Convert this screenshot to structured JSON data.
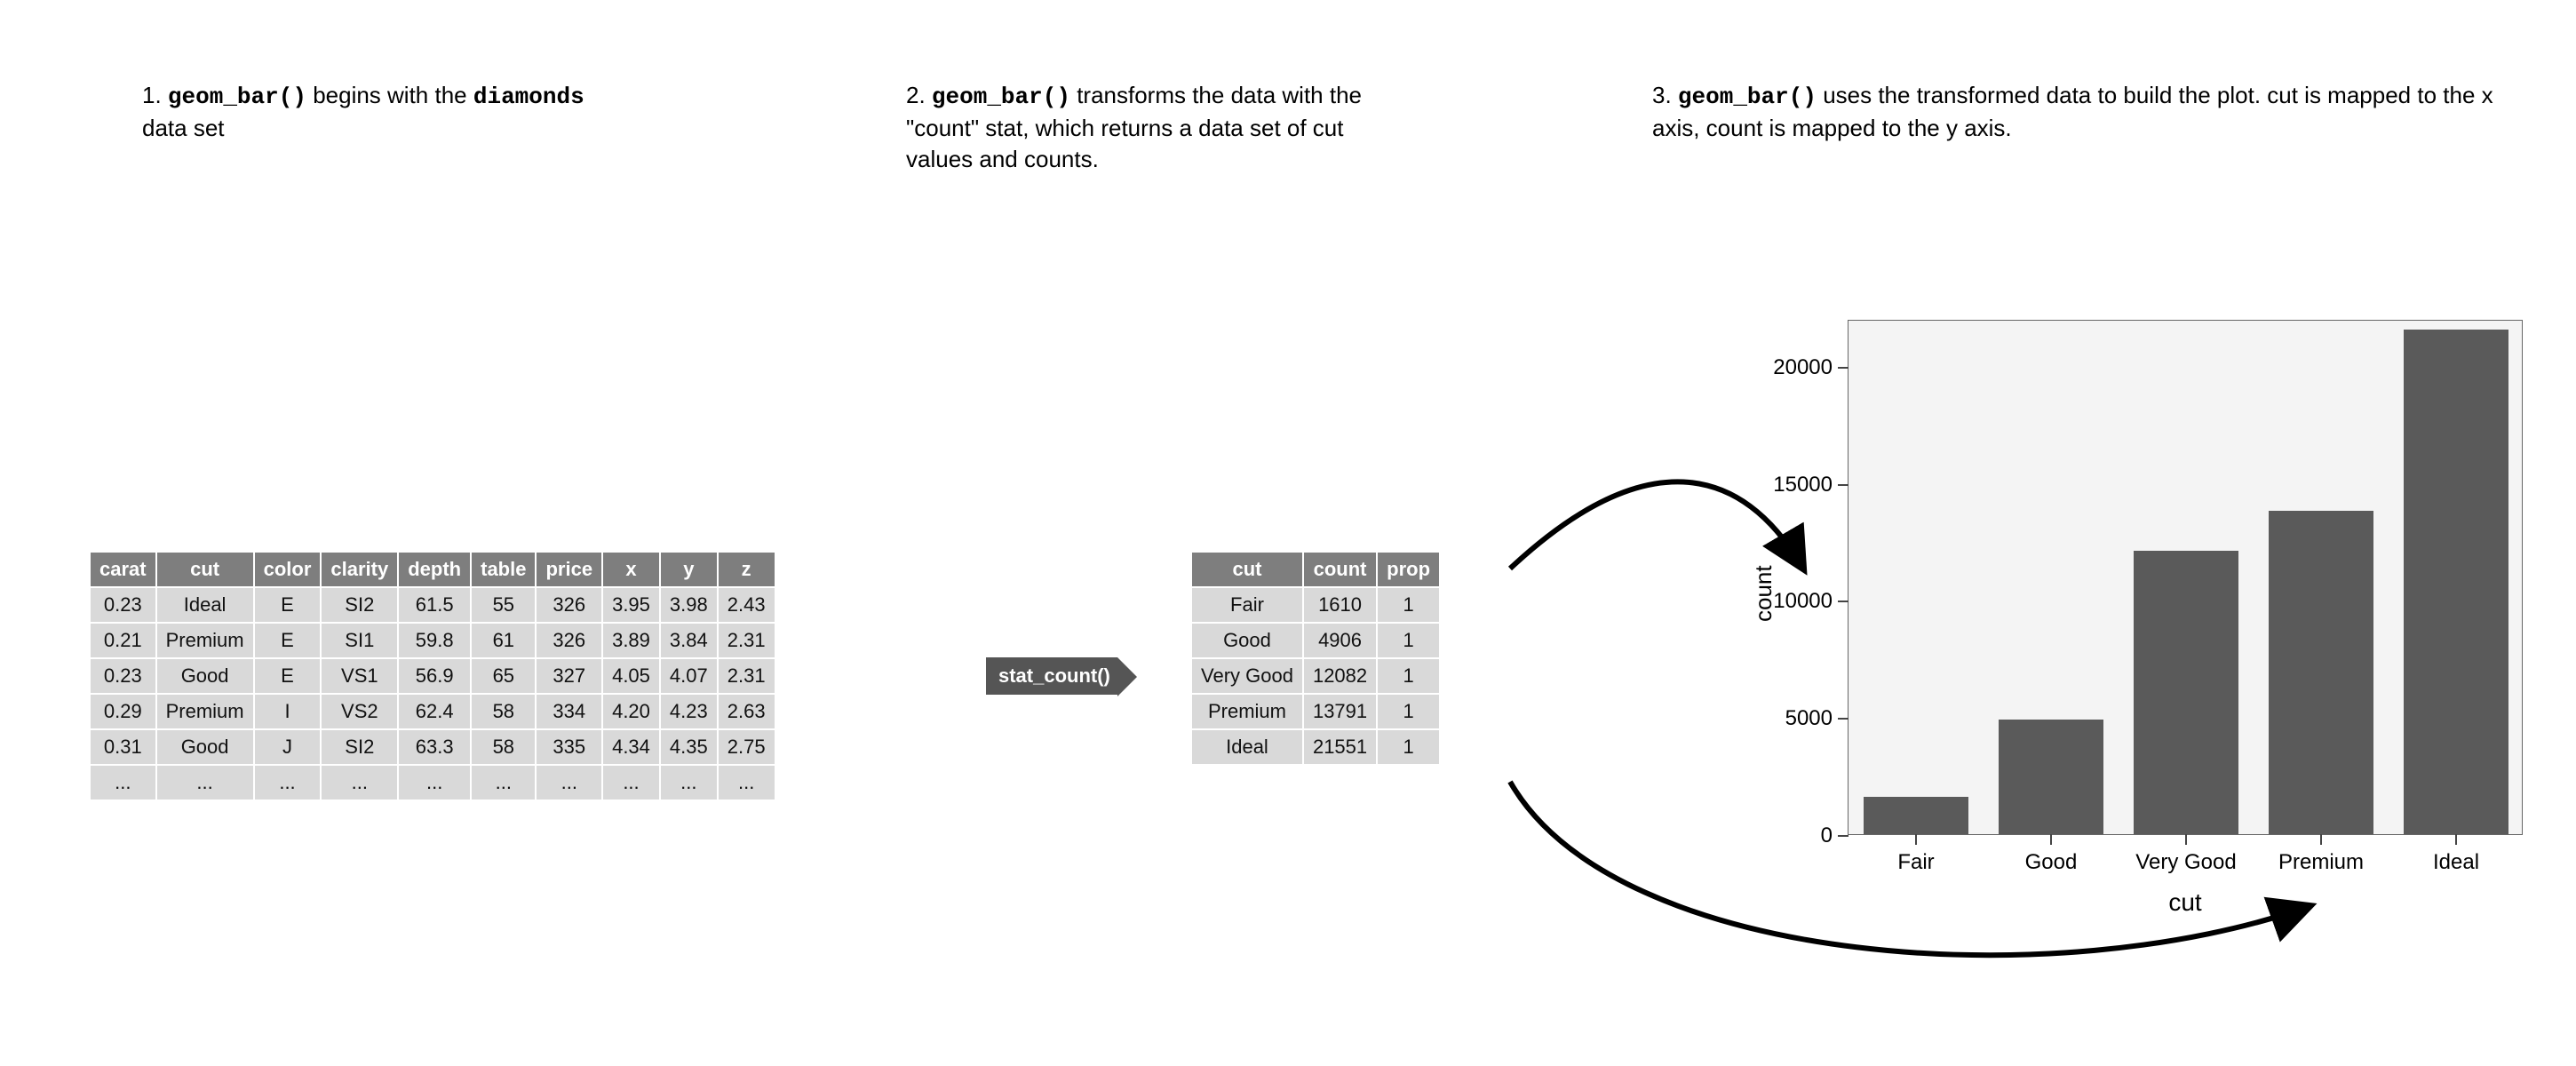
{
  "steps": {
    "s1": {
      "num": "1.",
      "code": "geom_bar()",
      "mid": " begins with the ",
      "code2": "diamonds",
      "tail": " data set"
    },
    "s2": {
      "num": "2.",
      "code": "geom_bar()",
      "tail": " transforms the data with the \"count\" stat, which returns a data set of cut values and counts."
    },
    "s3": {
      "num": "3.",
      "code": "geom_bar()",
      "tail": " uses the transformed data to build the plot. cut is mapped to the x axis, count is mapped to the y axis."
    }
  },
  "tag_label": "stat_count()",
  "diamonds_table": {
    "headers": [
      "carat",
      "cut",
      "color",
      "clarity",
      "depth",
      "table",
      "price",
      "x",
      "y",
      "z"
    ],
    "rows": [
      [
        "0.23",
        "Ideal",
        "E",
        "SI2",
        "61.5",
        "55",
        "326",
        "3.95",
        "3.98",
        "2.43"
      ],
      [
        "0.21",
        "Premium",
        "E",
        "SI1",
        "59.8",
        "61",
        "326",
        "3.89",
        "3.84",
        "2.31"
      ],
      [
        "0.23",
        "Good",
        "E",
        "VS1",
        "56.9",
        "65",
        "327",
        "4.05",
        "4.07",
        "2.31"
      ],
      [
        "0.29",
        "Premium",
        "I",
        "VS2",
        "62.4",
        "58",
        "334",
        "4.20",
        "4.23",
        "2.63"
      ],
      [
        "0.31",
        "Good",
        "J",
        "SI2",
        "63.3",
        "58",
        "335",
        "4.34",
        "4.35",
        "2.75"
      ],
      [
        "...",
        "...",
        "...",
        "...",
        "...",
        "...",
        "...",
        "...",
        "...",
        "..."
      ]
    ]
  },
  "count_table": {
    "headers": [
      "cut",
      "count",
      "prop"
    ],
    "rows": [
      [
        "Fair",
        "1610",
        "1"
      ],
      [
        "Good",
        "4906",
        "1"
      ],
      [
        "Very Good",
        "12082",
        "1"
      ],
      [
        "Premium",
        "13791",
        "1"
      ],
      [
        "Ideal",
        "21551",
        "1"
      ]
    ]
  },
  "chart_data": {
    "type": "bar",
    "categories": [
      "Fair",
      "Good",
      "Very Good",
      "Premium",
      "Ideal"
    ],
    "values": [
      1610,
      4906,
      12082,
      13791,
      21551
    ],
    "xlabel": "cut",
    "ylabel": "count",
    "ylim": [
      0,
      22000
    ],
    "yticks": [
      0,
      5000,
      10000,
      15000,
      20000
    ],
    "ytick_labels": [
      "0",
      "5000",
      "10000",
      "15000",
      "20000"
    ]
  }
}
